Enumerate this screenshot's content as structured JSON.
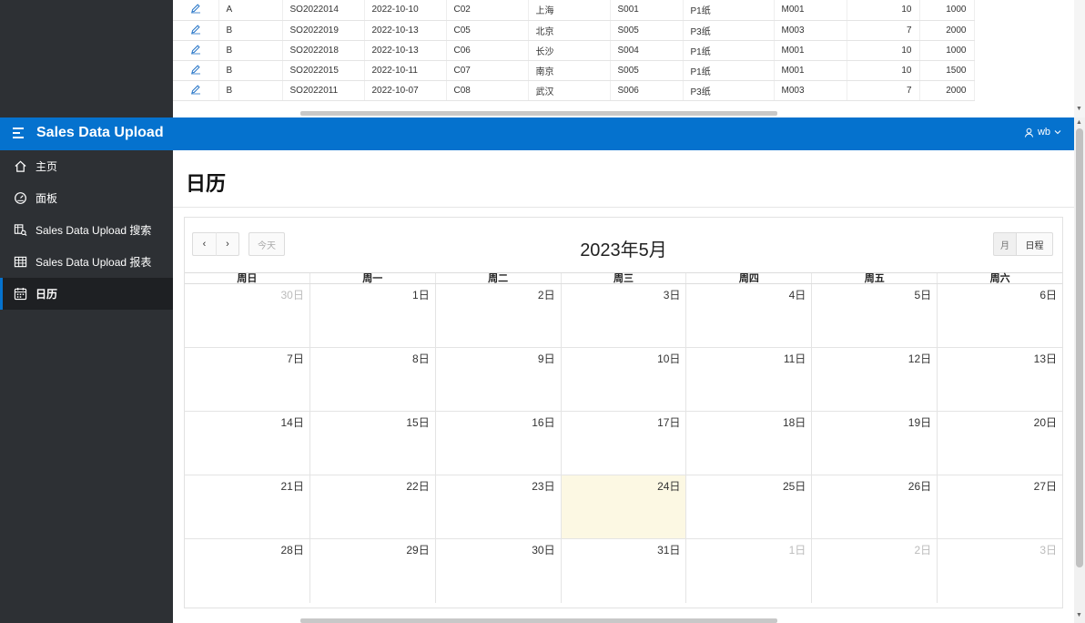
{
  "top_table": {
    "rows": [
      [
        "A",
        "SO2022014",
        "2022-10-10",
        "C02",
        "上海",
        "S001",
        "P1纸",
        "M001",
        "10",
        "1000"
      ],
      [
        "B",
        "SO2022019",
        "2022-10-13",
        "C05",
        "北京",
        "S005",
        "P3纸",
        "M003",
        "7",
        "2000"
      ],
      [
        "B",
        "SO2022018",
        "2022-10-13",
        "C06",
        "长沙",
        "S004",
        "P1纸",
        "M001",
        "10",
        "1000"
      ],
      [
        "B",
        "SO2022015",
        "2022-10-11",
        "C07",
        "南京",
        "S005",
        "P1纸",
        "M001",
        "10",
        "1500"
      ],
      [
        "B",
        "SO2022011",
        "2022-10-07",
        "C08",
        "武汉",
        "S006",
        "P3纸",
        "M003",
        "7",
        "2000"
      ]
    ]
  },
  "header": {
    "title": "Sales Data Upload",
    "user": "wb"
  },
  "nav": {
    "items": [
      {
        "label": "主页",
        "icon": "home-icon"
      },
      {
        "label": "面板",
        "icon": "dashboard-icon"
      },
      {
        "label": "Sales Data Upload 搜索",
        "icon": "search-report-icon"
      },
      {
        "label": "Sales Data Upload 报表",
        "icon": "table-icon"
      },
      {
        "label": "日历",
        "icon": "calendar-icon",
        "active": true
      }
    ]
  },
  "page": {
    "title": "日历"
  },
  "calendar": {
    "title": "2023年5月",
    "prev_label": "‹",
    "next_label": "›",
    "today_label": "今天",
    "view_month_label": "月",
    "view_agenda_label": "日程",
    "weekdays": [
      "周日",
      "周一",
      "周二",
      "周三",
      "周四",
      "周五",
      "周六"
    ],
    "weeks": [
      [
        "30日",
        "1日",
        "2日",
        "3日",
        "4日",
        "5日",
        "6日"
      ],
      [
        "7日",
        "8日",
        "9日",
        "10日",
        "11日",
        "12日",
        "13日"
      ],
      [
        "14日",
        "15日",
        "16日",
        "17日",
        "18日",
        "19日",
        "20日"
      ],
      [
        "21日",
        "22日",
        "23日",
        "24日",
        "25日",
        "26日",
        "27日"
      ],
      [
        "28日",
        "29日",
        "30日",
        "31日",
        "1日",
        "2日",
        "3日"
      ]
    ],
    "today_day": "24日",
    "colors": {
      "today_bg": "#fcf8e3",
      "header_bg": "#0572ce",
      "sidebar_bg": "#2d3034"
    }
  }
}
